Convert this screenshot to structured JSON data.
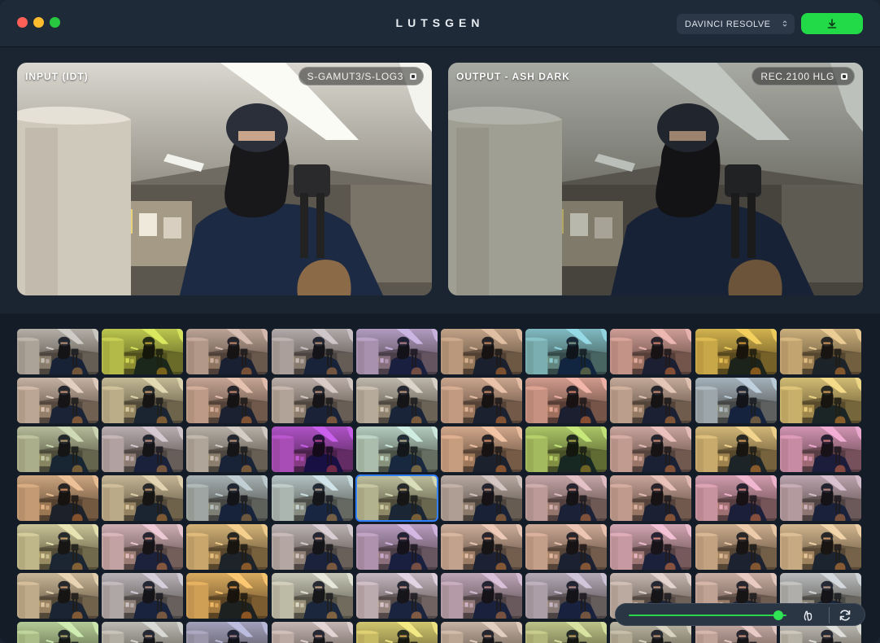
{
  "window": {
    "title": "LUTSGEN",
    "target_app": "DAVINCI RESOLVE",
    "colors": {
      "accent": "#22d947",
      "selection": "#2f80ff",
      "background": "#17202c"
    }
  },
  "toolbar": {
    "download_icon": "download-icon",
    "select_icon": "chevron-updown-icon"
  },
  "input_panel": {
    "label": "INPUT (IDT)",
    "colorspace": "S-GAMUT3/S-LOG3"
  },
  "output_panel": {
    "label": "OUTPUT - ASH DARK",
    "colorspace": "REC.2100 HLG"
  },
  "grid": {
    "columns": 10,
    "visible_rows": 7,
    "selected_index": 34,
    "tints": [
      "#b8b1b0",
      "#c8e000",
      "#c79a8e",
      "#b7a9b6",
      "#b28ce0",
      "#d39a70",
      "#56c8e6",
      "#e8908c",
      "#f2b900",
      "#e5b35a",
      "#d8b6a8",
      "#d6c78c",
      "#dca08a",
      "#c6b2b2",
      "#cdc2b8",
      "#e4a07e",
      "#f08c7e",
      "#d9a894",
      "#9db8d8",
      "#f2cc4a",
      "#b8c894",
      "#c4b0c4",
      "#c0b4b0",
      "#b000f0",
      "#b8e8e0",
      "#f0a478",
      "#a8e030",
      "#e4a0a0",
      "#f0c050",
      "#f080c8",
      "#e8a060",
      "#d8c08c",
      "#9fb6c6",
      "#b8d8e8",
      "#c8d09a",
      "#c0a8a8",
      "#d8a0b0",
      "#e0a098",
      "#f090c0",
      "#c8a0c0",
      "#e0d890",
      "#e8b0c8",
      "#f4b850",
      "#c8b8c8",
      "#c090e0",
      "#e8b098",
      "#e8a890",
      "#f0a0c8",
      "#e8b080",
      "#f0c080",
      "#e0c090",
      "#c0b8d0",
      "#ffaa20",
      "#dce0d0",
      "#d8c0e0",
      "#c8a0d0",
      "#b8a8d0",
      "#d8c0c0",
      "#e0b0a8",
      "#c0c8d8",
      "#b8e890",
      "#c8c8c8",
      "#9898d8",
      "#d8c0c8",
      "#f0e040",
      "#d8b8a8",
      "#c8d870",
      "#c8c0a8",
      "#e0b0b0",
      "#d0d0d0"
    ]
  },
  "controls": {
    "intensity": 0.95,
    "compare_icon": "compare-hand-icon",
    "refresh_icon": "refresh-icon"
  }
}
